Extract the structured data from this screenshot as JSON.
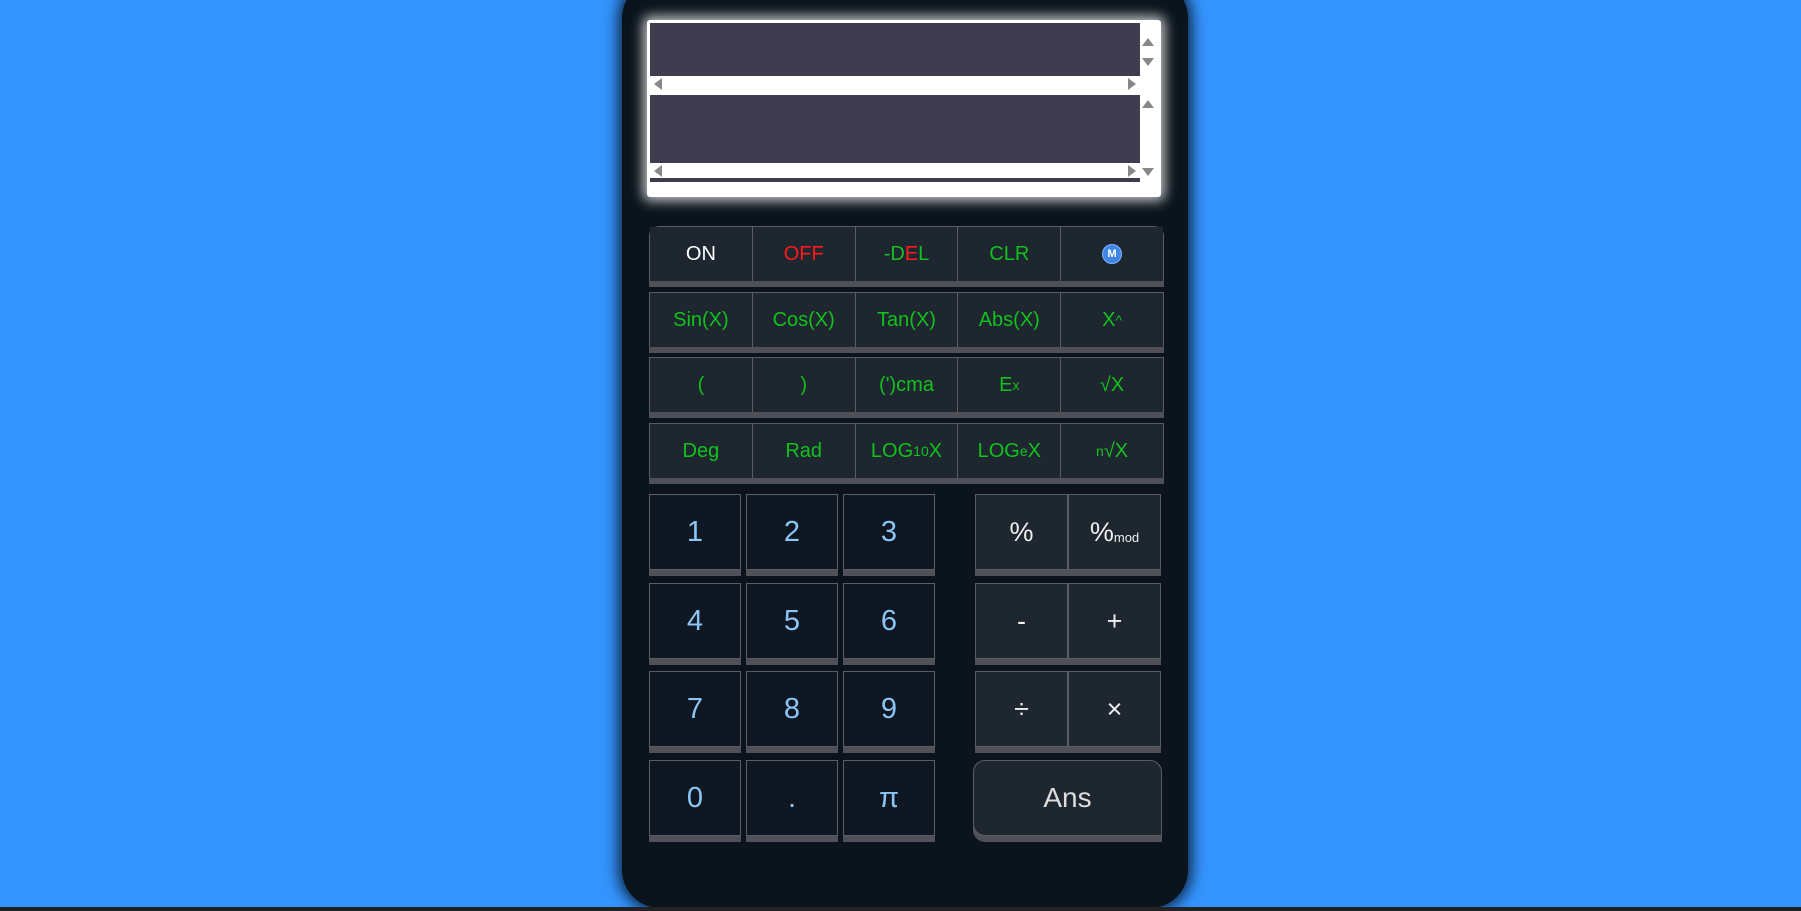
{
  "colors": {
    "background": "#3494fe",
    "calculator_body": "#0b141c",
    "function_text": "#12c21c",
    "digit_text": "#8bc5f4",
    "off_text": "#ff1a1a",
    "on_text": "#ffffff",
    "display_screen": "#3f3c4f"
  },
  "display": {
    "expression": "",
    "result": ""
  },
  "function_rows": [
    {
      "items": [
        {
          "label": "ON"
        },
        {
          "label": "OFF"
        },
        {
          "label": "-DEL"
        },
        {
          "label": "CLR"
        },
        {
          "icon": "m-circle-icon",
          "label": "M"
        }
      ]
    },
    {
      "items": [
        {
          "label": "Sin(X)"
        },
        {
          "label": "Cos(X)"
        },
        {
          "label": "Tan(X)"
        },
        {
          "label": "Abs(X)"
        },
        {
          "base": "X",
          "sup": "^"
        }
      ]
    },
    {
      "items": [
        {
          "label": "("
        },
        {
          "label": ")"
        },
        {
          "label": "(')cma"
        },
        {
          "base": "E",
          "sup": "x"
        },
        {
          "label": "√X"
        }
      ]
    },
    {
      "items": [
        {
          "label": "Deg"
        },
        {
          "label": "Rad"
        },
        {
          "pre": "LOG",
          "sub": "10",
          "post": "X"
        },
        {
          "pre": "LOG",
          "sub": "e",
          "post": "X"
        },
        {
          "sup": "n",
          "post": "√X"
        }
      ]
    }
  ],
  "digits": [
    "1",
    "2",
    "3",
    "4",
    "5",
    "6",
    "7",
    "8",
    "9",
    "0",
    ".",
    "π"
  ],
  "operators": {
    "percent": "%",
    "mod_main": "%",
    "mod_sub": "mod",
    "minus": "-",
    "plus": "+",
    "divide": "÷",
    "multiply": "×",
    "answer": "Ans"
  }
}
